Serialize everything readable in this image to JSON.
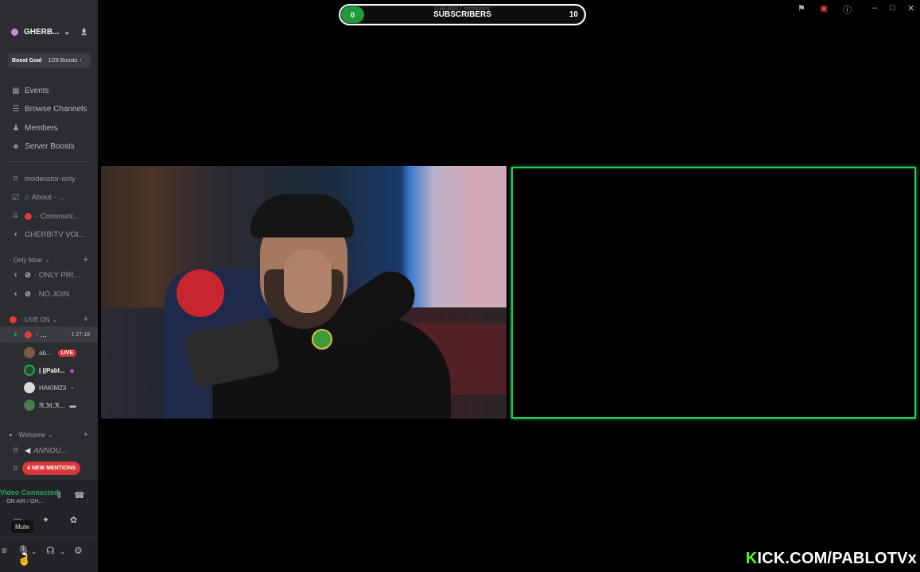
{
  "server": {
    "name": "GHERB...",
    "boost_label": "Boost Goal",
    "boost_progress": "1/28 Boosts"
  },
  "nav": [
    {
      "label": "Events",
      "icon": "calendar-icon"
    },
    {
      "label": "Browse Channels",
      "icon": "browse-channels-icon"
    },
    {
      "label": "Members",
      "icon": "members-icon"
    },
    {
      "label": "Server Boosts",
      "icon": "boost-icon"
    }
  ],
  "channels": {
    "moderator": "moderator-only",
    "about": "About · ...",
    "community": "· Communi...",
    "voice_main": "GHERBITV VOI..."
  },
  "categories": {
    "only_ikbar": "· Only Ikbar",
    "live_on": "· LIVE ON",
    "welcome": "· Welcome"
  },
  "only_ikbar_channels": [
    "· ONLY PRI...",
    "· NO JOIN"
  ],
  "live_channel": {
    "label": "· ...",
    "timer": "1:27:18"
  },
  "voice_users": [
    {
      "name": "ab...",
      "badge": "LIVE"
    },
    {
      "name": "| ||Pabl..."
    },
    {
      "name": "HAKIM23"
    },
    {
      "name": "ℛ.ℳ.ℛ..."
    }
  ],
  "welcome_channel": "ANNOU...",
  "mentions": "4 NEW MENTIONS",
  "voice_panel": {
    "title": "Video Connected",
    "subtitle": "· ON AIR / GH..."
  },
  "tooltip": "Mute",
  "overlay": {
    "start": "0",
    "label": "SUBSCRIBERS",
    "goal": "10",
    "ghost_title": "GHERBI Community"
  },
  "watermark": {
    "k": "K",
    "rest": "ICK.COM/PABLOTVx"
  }
}
